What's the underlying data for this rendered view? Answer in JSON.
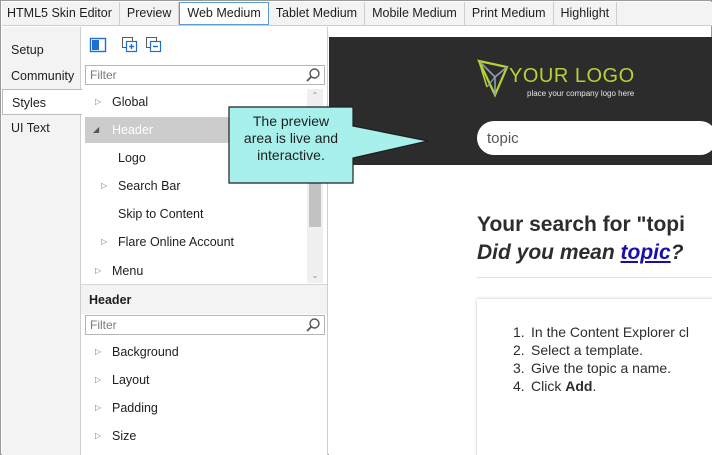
{
  "top_tabs": [
    {
      "label": "HTML5 Skin Editor"
    },
    {
      "label": "Preview"
    },
    {
      "label": "Web Medium"
    },
    {
      "label": "Tablet Medium"
    },
    {
      "label": "Mobile Medium"
    },
    {
      "label": "Print Medium"
    },
    {
      "label": "Highlight"
    }
  ],
  "side_tabs": [
    {
      "label": "Setup"
    },
    {
      "label": "Community"
    },
    {
      "label": "Styles"
    },
    {
      "label": "UI Text"
    }
  ],
  "filter_placeholder": "Filter",
  "tree": [
    {
      "label": "Global",
      "expander": "collapsed"
    },
    {
      "label": "Header",
      "expander": "expanded"
    },
    {
      "label": "Logo",
      "expander": "none"
    },
    {
      "label": "Search Bar",
      "expander": "collapsed"
    },
    {
      "label": "Skip to Content",
      "expander": "none"
    },
    {
      "label": "Flare Online Account",
      "expander": "collapsed"
    },
    {
      "label": "Menu",
      "expander": "collapsed"
    }
  ],
  "properties_heading": "Header",
  "properties_filter_placeholder": "Filter",
  "properties": [
    {
      "label": "Background"
    },
    {
      "label": "Layout"
    },
    {
      "label": "Padding"
    },
    {
      "label": "Size"
    }
  ],
  "preview": {
    "logo_text": "YOUR LOGO",
    "logo_subtext": "place your company logo here",
    "search_value": "topic",
    "result_heading": "Your search for \"topi",
    "did_you_mean_prefix": "Did you mean ",
    "did_you_mean_link": "topic",
    "did_you_mean_suffix": "?",
    "steps": [
      {
        "num": "1.",
        "text": "In the Content Explorer cl",
        "bold": ""
      },
      {
        "num": "2.",
        "text": "Select a template.",
        "bold": ""
      },
      {
        "num": "3.",
        "text": "Give the topic a name.",
        "bold": ""
      },
      {
        "num": "4.",
        "text": "Click ",
        "bold": "Add"
      }
    ],
    "steps_4_suffix": "."
  },
  "callout": {
    "line1": "The preview",
    "line2": "area is live and",
    "line3": "interactive."
  },
  "colors": {
    "selected_row": "#cccccc",
    "active_tab_border": "#5b9bd5",
    "header_bg": "#2c2c2c",
    "logo_green": "#b5d334",
    "callout_fill": "#a8f0ec",
    "link": "#1a0dab"
  }
}
